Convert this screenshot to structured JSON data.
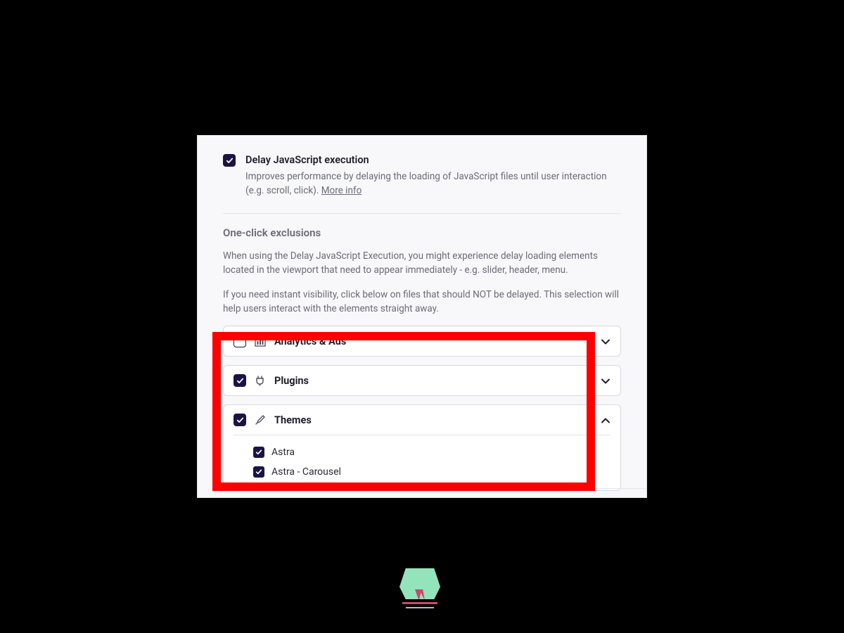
{
  "option": {
    "title": "Delay JavaScript execution",
    "checked": true,
    "description": "Improves performance by delaying the loading of JavaScript files until user interaction (e.g. scroll, click). ",
    "more_info_label": "More info"
  },
  "exclusions": {
    "heading": "One-click exclusions",
    "p1": "When using the Delay JavaScript Execution, you might experience delay loading elements located in the viewport that need to appear immediately - e.g. slider, header, menu.",
    "p2": "If you need instant visibility, click below on files that should NOT be delayed. This selection will help users interact with the elements straight away."
  },
  "groups": {
    "analytics": {
      "label": "Analytics & Ads",
      "checked": false,
      "expanded": false
    },
    "plugins": {
      "label": "Plugins",
      "checked": true,
      "expanded": false
    },
    "themes": {
      "label": "Themes",
      "checked": true,
      "expanded": true,
      "items": [
        {
          "label": "Astra",
          "checked": true
        },
        {
          "label": "Astra - Carousel",
          "checked": true
        }
      ]
    }
  }
}
